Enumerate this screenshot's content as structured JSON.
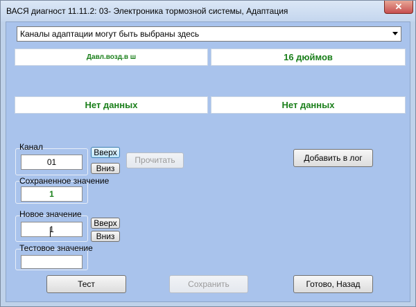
{
  "window": {
    "title": "ВАСЯ диагност 11.11.2: 03- Электроника тормозной системы, Адаптация",
    "close_label": "✕"
  },
  "channel_select": {
    "selected": "Каналы адаптации могут быть выбраны здесь"
  },
  "display": {
    "top_left": "Давл.возд.в ш",
    "top_right": "16 дюймов",
    "mid_left": "Нет данных",
    "mid_right": "Нет данных"
  },
  "channel": {
    "label": "Канал",
    "value": "01",
    "up": "Вверх",
    "down": "Вниз",
    "read": "Прочитать"
  },
  "saved": {
    "label": "Сохраненное значение",
    "value": "1"
  },
  "new_value": {
    "label": "Новое значение",
    "value": "1",
    "up": "Вверх",
    "down": "Вниз"
  },
  "test_value": {
    "label": "Тестовое значение",
    "value": ""
  },
  "actions": {
    "add_to_log": "Добавить в лог",
    "test": "Тест",
    "save": "Сохранить",
    "done_back": "Готово, Назад"
  }
}
